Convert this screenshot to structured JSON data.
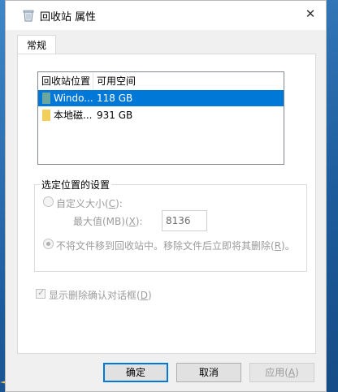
{
  "window": {
    "title": "回收站 属性",
    "close_glyph": "✕"
  },
  "tabs": [
    {
      "label": "常规",
      "active": true
    }
  ],
  "listview": {
    "columns": [
      "回收站位置",
      "可用空间"
    ],
    "rows": [
      {
        "location": "Windo...",
        "free_space": "118 GB",
        "selected": true,
        "icon_color": "#6aa7a0"
      },
      {
        "location": "本地磁...",
        "free_space": "931 GB",
        "selected": false,
        "icon_color": "#f2cf5b"
      }
    ]
  },
  "settings_group": {
    "label": "选定位置的设置",
    "custom_size": {
      "label": "自定义大小(",
      "key": "C",
      "suffix": "):"
    },
    "max_value": {
      "label": "最大值(MB)(",
      "key": "X",
      "suffix": "):",
      "value": "8136"
    },
    "delete_immediately": {
      "label": "不将文件移到回收站中。移除文件后立即将其删除(",
      "key": "R",
      "suffix": ")。",
      "selected": true
    }
  },
  "confirm_delete": {
    "label": "显示删除确认对话框(",
    "key": "D",
    "suffix": ")",
    "checked": true
  },
  "buttons": {
    "ok": "确定",
    "cancel": "取消",
    "apply": {
      "label": "应用(",
      "key": "A",
      "suffix": ")"
    }
  },
  "colors": {
    "accent": "#0078d7",
    "desktop": "#2a6fb0"
  }
}
